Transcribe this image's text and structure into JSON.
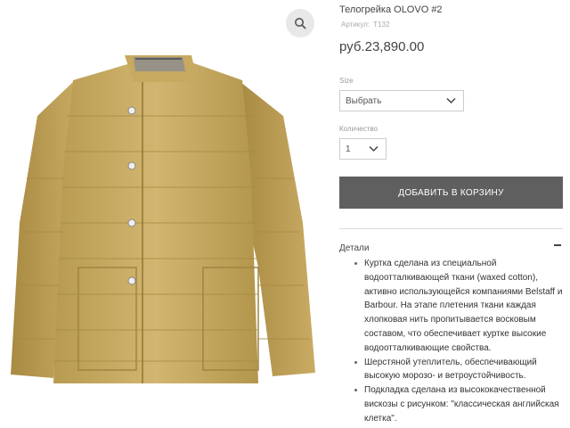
{
  "product": {
    "title": "Телогрейка OLOVO #2",
    "sku_label": "Артикул:",
    "sku_value": "T132",
    "price": "руб.23,890.00",
    "image_icon": "zoom-magnifier-icon"
  },
  "options": {
    "size_label": "Size",
    "size_value": "Выбрать",
    "quantity_label": "Количество",
    "quantity_value": "1"
  },
  "cart": {
    "add_label": "ДОБАВИТЬ В КОРЗИНУ",
    "button_color": "#5f5f5f"
  },
  "details": {
    "heading": "Детали",
    "items": [
      "Куртка сделана из специальной водоотталкивающей ткани (waxed cotton), активно использующейся компаниями Belstaff и Barbour. На этапе плетения ткани каждая хлопковая нить пропитывается восковым составом, что обеспечивает куртке высокие водоотталкивающие свойства.",
      "Шерстяной утеплитель, обеспечивающий высокую морозо- и ветроустойчивость.",
      "Подкладка сделана из высококачественной вискозы с рисунком: \"классическая английская клетка\"."
    ]
  }
}
